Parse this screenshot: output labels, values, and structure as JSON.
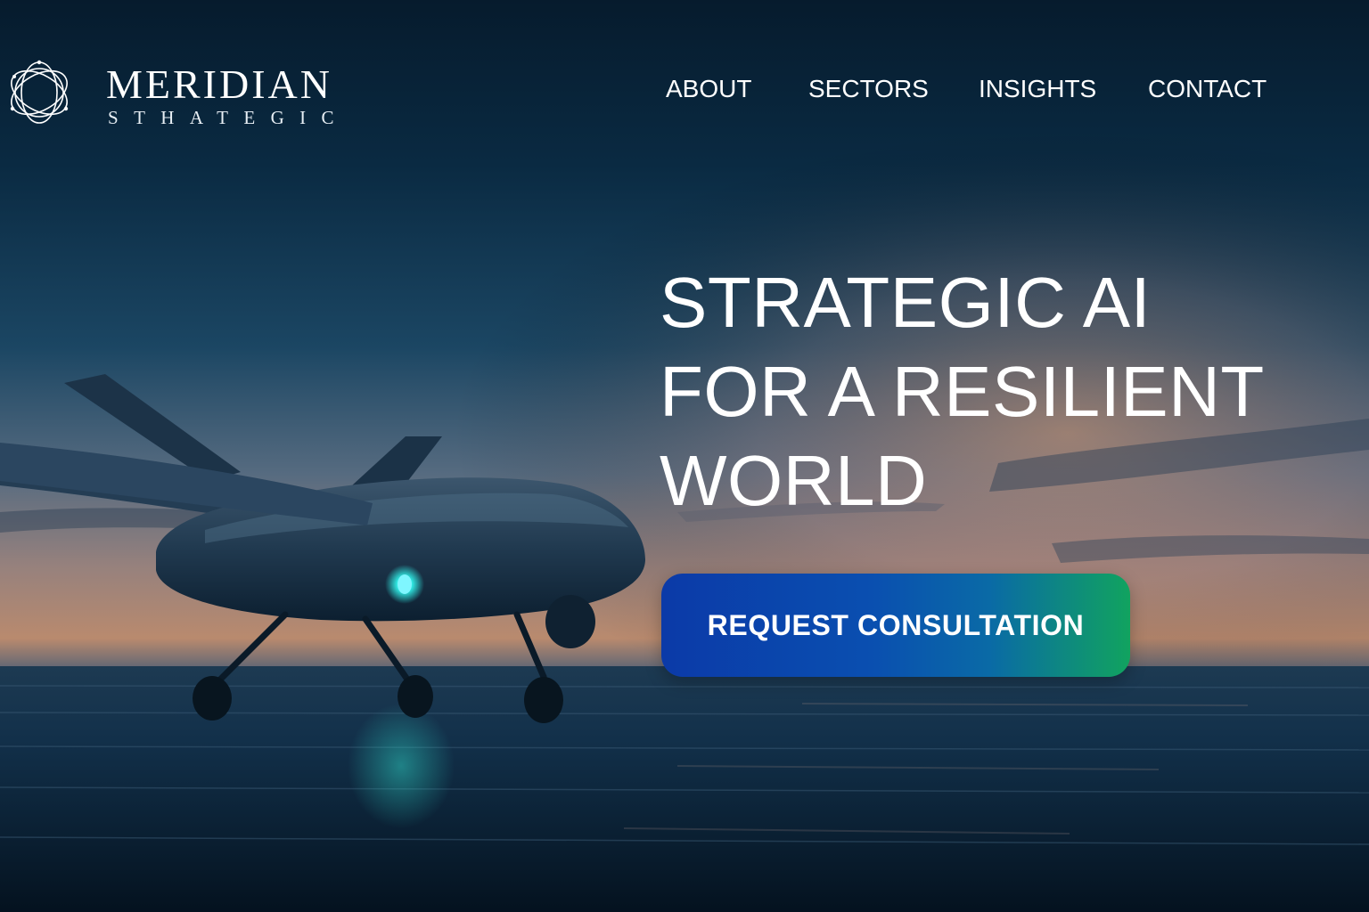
{
  "brand": {
    "name": "MERIDIAN",
    "subtitle": "STHATEGIC"
  },
  "nav": {
    "items": [
      {
        "label": "ABOUT"
      },
      {
        "label": "SECTORS"
      },
      {
        "label": "INSIGHTS"
      },
      {
        "label": "CONTACT"
      }
    ]
  },
  "hero": {
    "headline_lines": [
      "STRATEGIC AI",
      "FOR A RESILIENT",
      "WORLD"
    ],
    "cta_label": "REQUEST CONSULTATION",
    "image": "drone-over-ocean-at-dusk"
  },
  "colors": {
    "cta_gradient_start": "#0b3aa8",
    "cta_gradient_end": "#11a35f",
    "sky_top": "#0b2236",
    "sunset_glow": "#c98a6a",
    "sea": "#0b2334",
    "drone_light": "#2fe6e0"
  },
  "icons": {
    "logo": "orbital-rings-icon"
  }
}
